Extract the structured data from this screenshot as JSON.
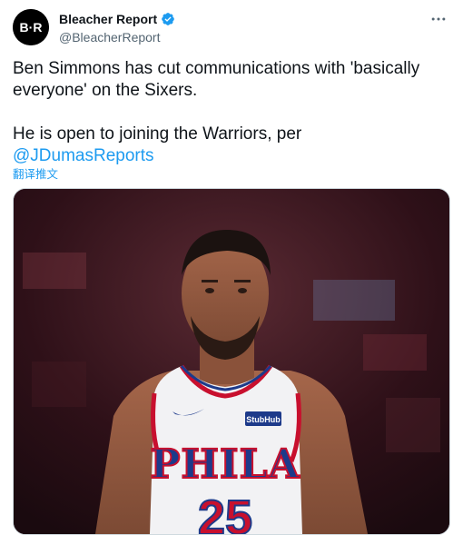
{
  "author": {
    "name": "Bleacher Report",
    "handle": "@BleacherReport",
    "avatar_text": "B·R",
    "verified": true
  },
  "tweet": {
    "line1": "Ben Simmons has cut communications with 'basically everyone' on the Sixers.",
    "line2": "He is open to joining the Warriors, per",
    "mention": "@JDumasReports",
    "translate_label": "翻译推文"
  },
  "media": {
    "alt": "Ben Simmons in Sixers jersey",
    "jersey_text": "PHILA",
    "jersey_number": "25",
    "patch_text": "StubHub"
  },
  "icons": {
    "verified": "verified-badge-icon",
    "more": "more-horizontal-icon"
  },
  "colors": {
    "link": "#1d9bf0",
    "text": "#0f1419",
    "secondary": "#536471"
  }
}
